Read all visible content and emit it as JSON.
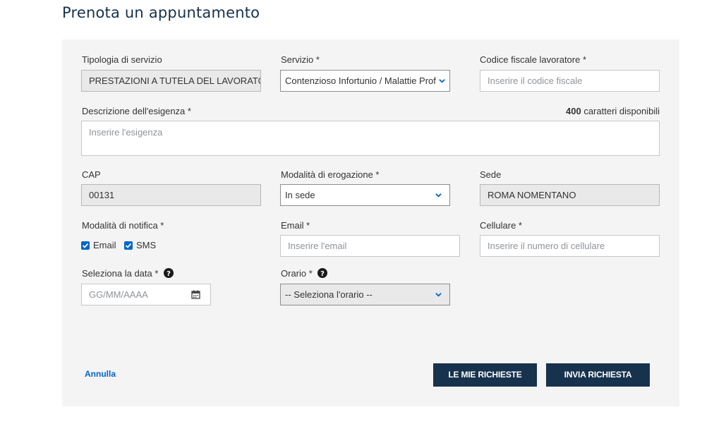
{
  "page": {
    "title": "Prenota un appuntamento"
  },
  "form": {
    "tipologia": {
      "label": "Tipologia di servizio",
      "value": "PRESTAZIONI A TUTELA DEL LAVORATO"
    },
    "servizio": {
      "label": "Servizio *",
      "value": "Contenzioso Infortunio / Malattie Prof"
    },
    "codice_fiscale": {
      "label": "Codice fiscale lavoratore *",
      "placeholder": "Inserire il codice fiscale"
    },
    "descrizione": {
      "label": "Descrizione dell'esigenza *",
      "placeholder": "Inserire l'esigenza",
      "counter_value": "400",
      "counter_text": "caratteri disponibili"
    },
    "cap": {
      "label": "CAP",
      "value": "00131"
    },
    "modalita_erogazione": {
      "label": "Modalità di erogazione *",
      "value": "In sede"
    },
    "sede": {
      "label": "Sede",
      "value": "ROMA NOMENTANO"
    },
    "modalita_notifica": {
      "label": "Modalità di notifica *",
      "options": [
        {
          "label": "Email",
          "checked": true
        },
        {
          "label": "SMS",
          "checked": true
        }
      ]
    },
    "email": {
      "label": "Email *",
      "placeholder": "Inserire l'email"
    },
    "cellulare": {
      "label": "Cellulare *",
      "placeholder": "Inserire il numero di cellulare"
    },
    "data": {
      "label": "Seleziona la data *",
      "placeholder": "GG/MM/AAAA"
    },
    "orario": {
      "label": "Orario *",
      "value": "-- Seleziona l'orario --"
    }
  },
  "actions": {
    "cancel_label": "Annulla",
    "my_requests_label": "LE MIE RICHIESTE",
    "submit_label": "INVIA RICHIESTA"
  },
  "colors": {
    "title": "#17324d",
    "panel_bg": "#f4f4f4",
    "primary_button": "#17324d",
    "link": "#0066cc",
    "checkbox": "#0066cc"
  },
  "icons": [
    "chevron-down-icon",
    "calendar-icon",
    "question-circle-icon",
    "check-icon"
  ]
}
